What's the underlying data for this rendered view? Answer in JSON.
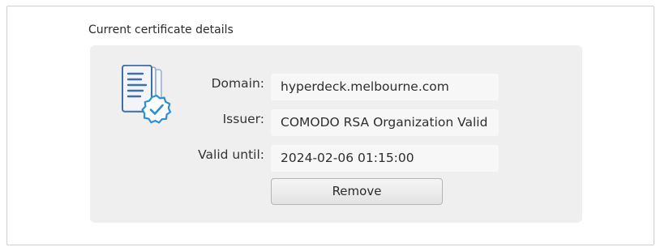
{
  "section": {
    "title": "Current certificate details"
  },
  "certificate": {
    "icon": "certificate-verified-icon",
    "fields": [
      {
        "label": "Domain:",
        "value": "hyperdeck.melbourne.com"
      },
      {
        "label": "Issuer:",
        "value": "COMODO RSA Organization Valid"
      },
      {
        "label": "Valid until:",
        "value": "2024-02-06 01:15:00"
      }
    ],
    "remove_label": "Remove"
  },
  "colors": {
    "accent": "#2a8fd8",
    "icon_stroke": "#3f6fa6",
    "panel_bg": "#efefef"
  }
}
